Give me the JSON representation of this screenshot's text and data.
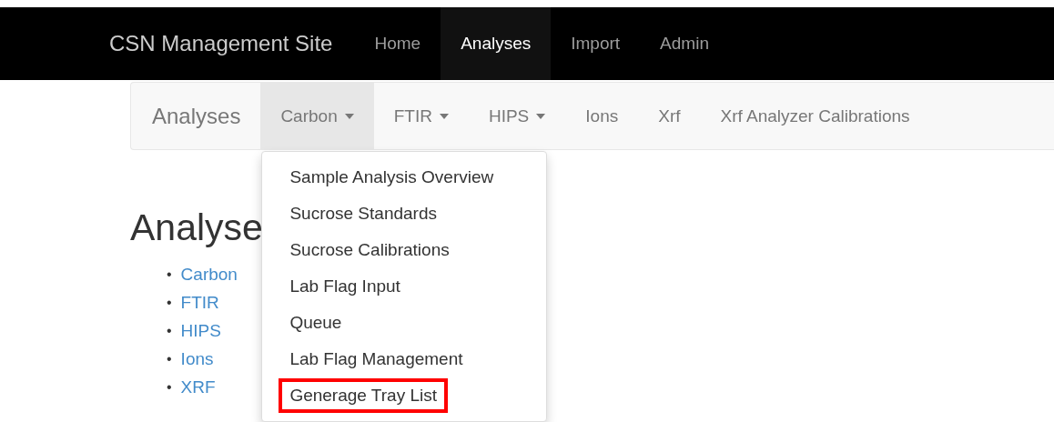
{
  "top_nav": {
    "brand": "CSN Management Site",
    "items": [
      {
        "label": "Home",
        "selected": false
      },
      {
        "label": "Analyses",
        "selected": true
      },
      {
        "label": "Import",
        "selected": false
      },
      {
        "label": "Admin",
        "selected": false
      }
    ]
  },
  "sub_nav": {
    "brand": "Analyses",
    "items": [
      {
        "label": "Carbon",
        "dropdown": true,
        "expanded": true
      },
      {
        "label": "FTIR",
        "dropdown": true,
        "expanded": false
      },
      {
        "label": "HIPS",
        "dropdown": true,
        "expanded": false
      },
      {
        "label": "Ions",
        "dropdown": false,
        "expanded": false
      },
      {
        "label": "Xrf",
        "dropdown": false,
        "expanded": false
      },
      {
        "label": "Xrf Analyzer Calibrations",
        "dropdown": false,
        "expanded": false
      }
    ]
  },
  "dropdown_menu": {
    "items": [
      {
        "label": "Sample Analysis Overview",
        "highlighted": false
      },
      {
        "label": "Sucrose Standards",
        "highlighted": false
      },
      {
        "label": "Sucrose Calibrations",
        "highlighted": false
      },
      {
        "label": "Lab Flag Input",
        "highlighted": false
      },
      {
        "label": "Queue",
        "highlighted": false
      },
      {
        "label": "Lab Flag Management",
        "highlighted": false
      },
      {
        "label": "Generage Tray List",
        "highlighted": true
      }
    ]
  },
  "page": {
    "heading": "Analyse",
    "links": [
      {
        "marker": "•",
        "label": "Carbon"
      },
      {
        "marker": "•",
        "label": "FTIR"
      },
      {
        "marker": "•",
        "label": "HIPS"
      },
      {
        "marker": "•",
        "label": "Ions"
      },
      {
        "marker": "•",
        "label": "XRF"
      }
    ]
  }
}
